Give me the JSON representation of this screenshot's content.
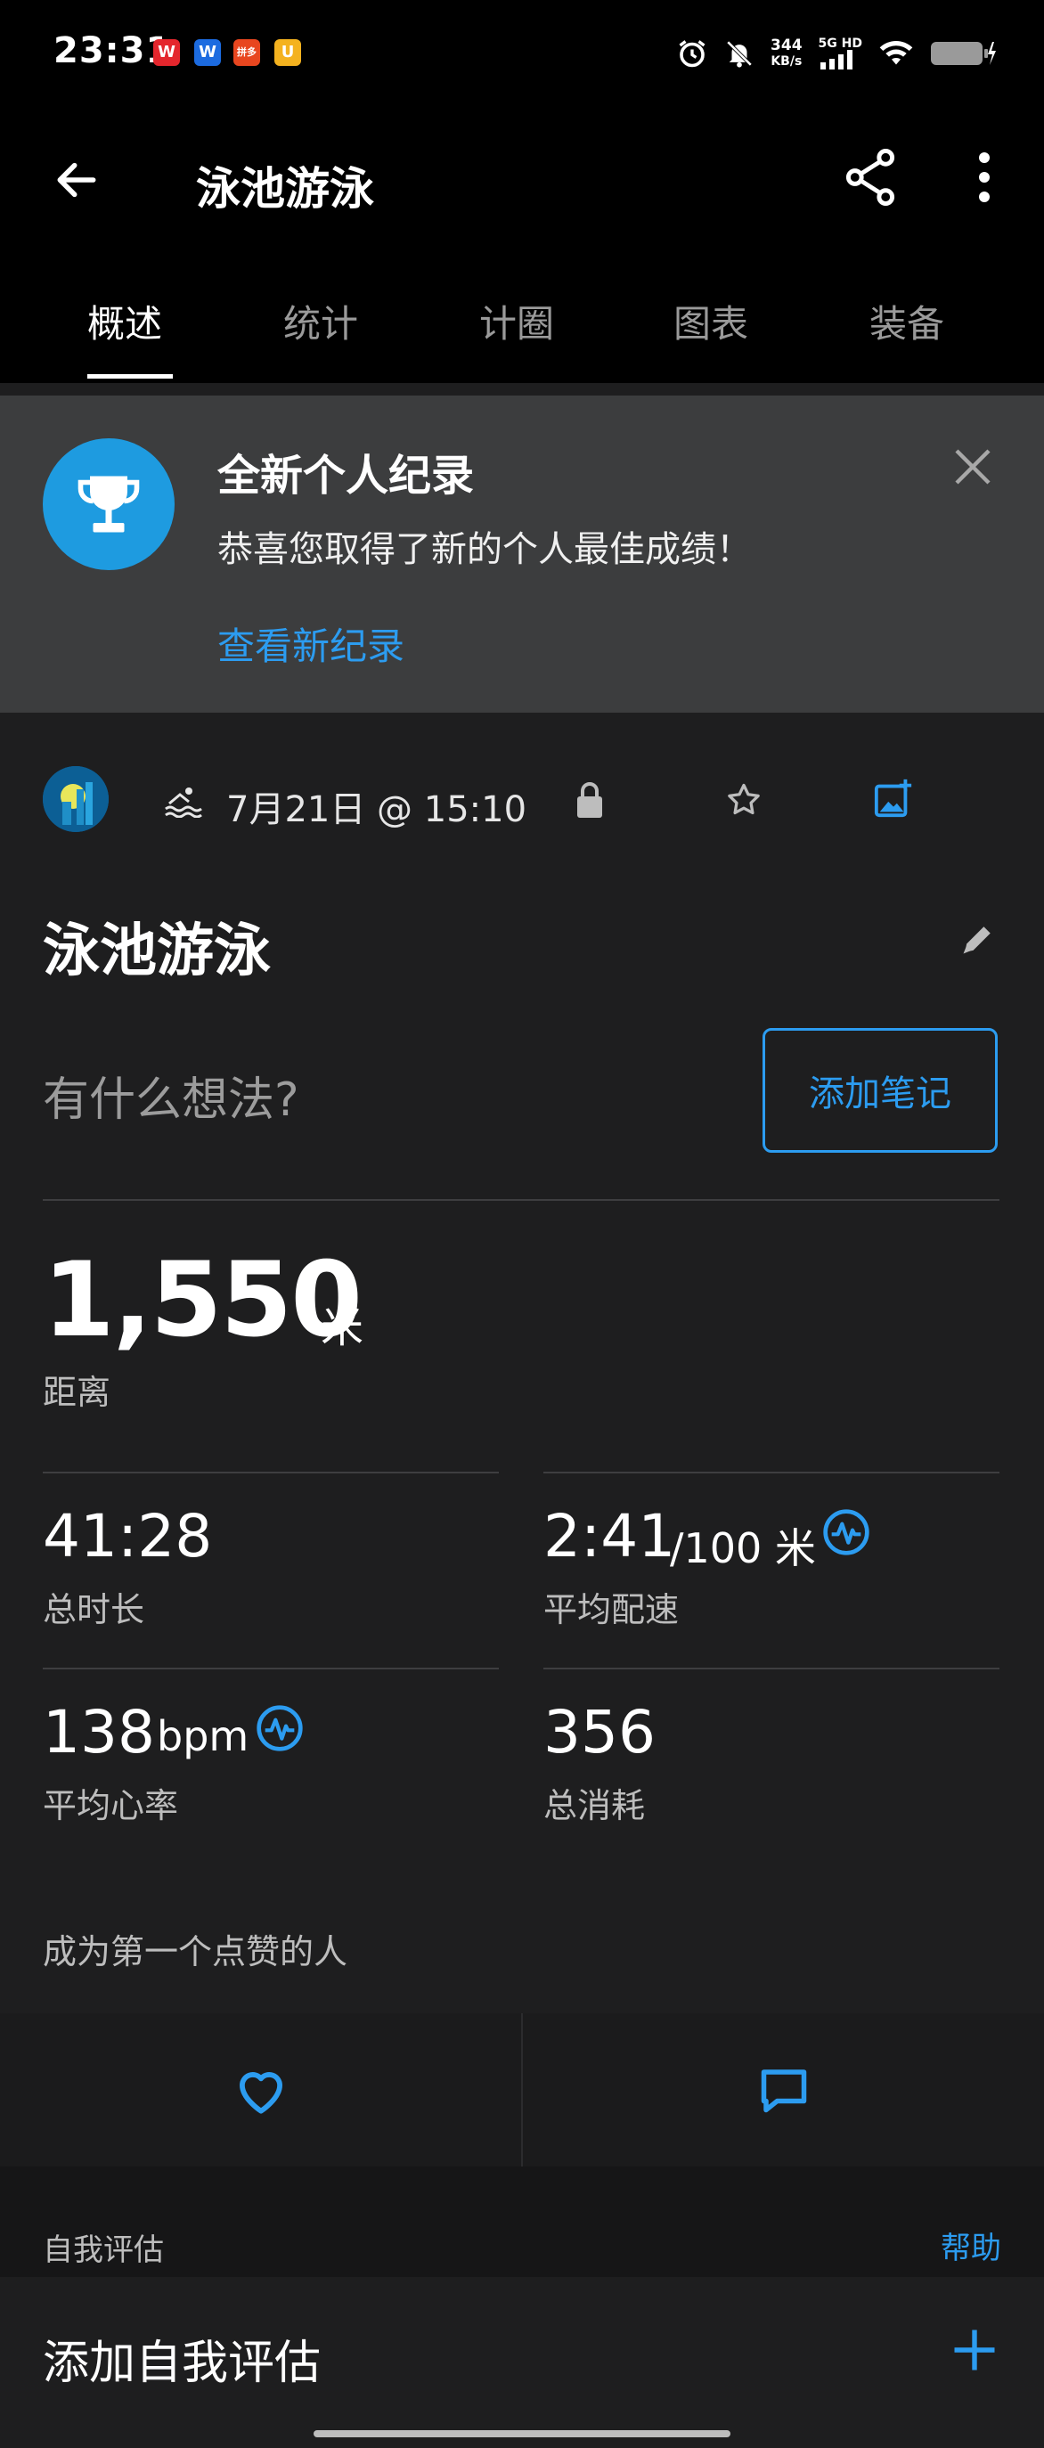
{
  "status_bar": {
    "time": "23:31",
    "app_badges": [
      "W",
      "W",
      "拼多",
      "U"
    ],
    "net_speed_value": "344",
    "net_speed_unit": "KB/s",
    "network_type": "5G HD"
  },
  "header": {
    "title": "泳池游泳",
    "tabs": [
      "概述",
      "统计",
      "计圈",
      "图表",
      "装备"
    ],
    "active_tab": 0
  },
  "banner": {
    "title": "全新个人纪录",
    "subtitle": "恭喜您取得了新的个人最佳成绩！",
    "link": "查看新纪录"
  },
  "activity": {
    "date_time": "7月21日 @ 15:10",
    "name": "泳池游泳",
    "note_placeholder": "有什么想法?",
    "add_note_label": "添加笔记"
  },
  "stats": {
    "distance": {
      "value": "1,550",
      "unit": "米",
      "label": "距离"
    },
    "duration": {
      "value": "41:28",
      "label": "总时长"
    },
    "pace": {
      "value": "2:41",
      "unit": "/100 米",
      "label": "平均配速"
    },
    "heart_rate": {
      "value": "138",
      "unit": "bpm",
      "label": "平均心率"
    },
    "calories": {
      "value": "356",
      "label": "总消耗"
    }
  },
  "social": {
    "likes_text": "成为第一个点赞的人"
  },
  "self_eval": {
    "section_title": "自我评估",
    "help_label": "帮助",
    "add_label": "添加自我评估"
  },
  "colors": {
    "accent": "#2c9cf0",
    "background": "#1e1e1f",
    "banner_bg": "#3c3d3e",
    "trophy_bg": "#1e9be0"
  }
}
